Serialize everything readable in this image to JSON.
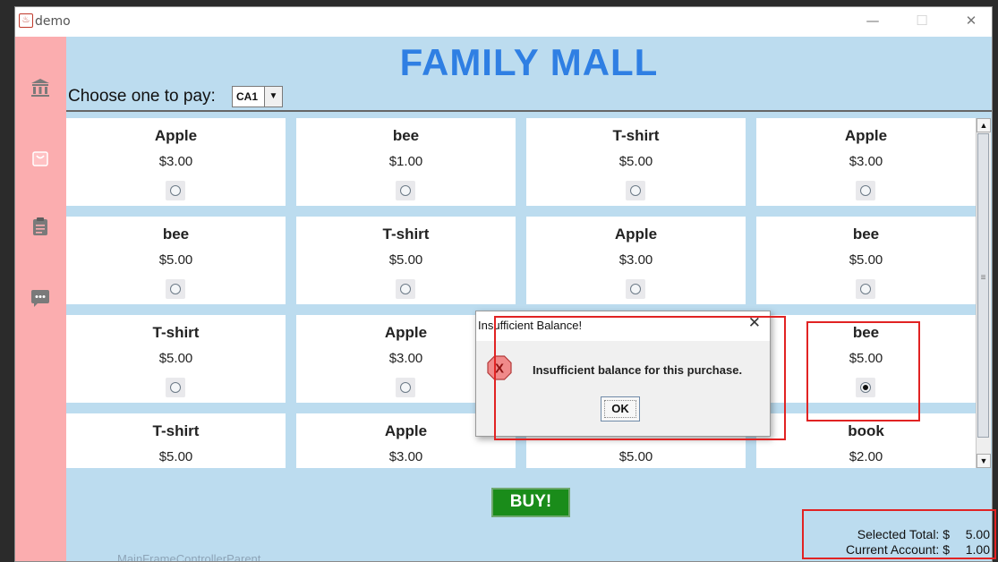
{
  "window": {
    "title": "demo",
    "min_label": "—",
    "max_label": "☐",
    "close_label": "✕",
    "app_icon_glyph": "♨"
  },
  "header": {
    "brand": "FAMILY MALL",
    "pay_label": "Choose one to pay:",
    "account_select": "CA1",
    "select_arrow": "▼"
  },
  "sidebar": {
    "icons": [
      "bank-icon",
      "shopping-bag-icon",
      "clipboard-icon",
      "chat-icon"
    ],
    "color": "#fbadaf"
  },
  "products": [
    {
      "name": "Apple",
      "price": "$3.00",
      "selected": false
    },
    {
      "name": "bee",
      "price": "$1.00",
      "selected": false
    },
    {
      "name": "T-shirt",
      "price": "$5.00",
      "selected": false
    },
    {
      "name": "Apple",
      "price": "$3.00",
      "selected": false
    },
    {
      "name": "bee",
      "price": "$5.00",
      "selected": false
    },
    {
      "name": "T-shirt",
      "price": "$5.00",
      "selected": false
    },
    {
      "name": "Apple",
      "price": "$3.00",
      "selected": false
    },
    {
      "name": "bee",
      "price": "$5.00",
      "selected": false
    },
    {
      "name": "T-shirt",
      "price": "$5.00",
      "selected": false
    },
    {
      "name": "Apple",
      "price": "$3.00",
      "selected": false
    },
    {
      "name": "",
      "price": "",
      "selected": false
    },
    {
      "name": "bee",
      "price": "$5.00",
      "selected": true
    },
    {
      "name": "T-shirt",
      "price": "$5.00",
      "selected": false
    },
    {
      "name": "Apple",
      "price": "$3.00",
      "selected": false
    },
    {
      "name": "",
      "price": "$5.00",
      "selected": false
    },
    {
      "name": "book",
      "price": "$2.00",
      "selected": false
    }
  ],
  "scrollbar": {
    "up": "▲",
    "down": "▼"
  },
  "buy_button": "BUY!",
  "totals": {
    "selected_label": "Selected Total: $",
    "selected_value": "5.00",
    "account_label": "Current Account: $",
    "account_value": "1.00"
  },
  "dialog": {
    "title": "Insufficient Balance!",
    "close": "✕",
    "icon_glyph": "X",
    "message": "Insufficient balance for this purchase.",
    "ok": "OK"
  },
  "background_text": "MainFrameControllerParent",
  "colors": {
    "brand": "#2f7fe3",
    "background": "#bcdcef",
    "buy": "#1a8c1a",
    "highlight": "#e12323",
    "error": "#e35a5a"
  }
}
